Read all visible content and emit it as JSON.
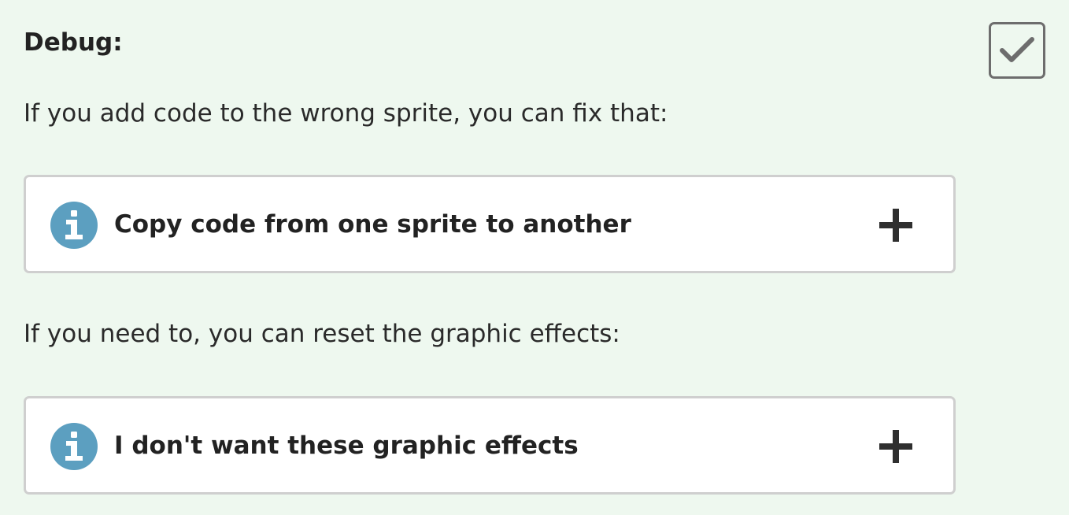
{
  "heading": "Debug:",
  "checkbox": {
    "checked": true,
    "icon": "check-icon"
  },
  "paragraphs": [
    "If you add code to the wrong sprite, you can fix that:",
    "If you need to, you can reset the graphic effects:"
  ],
  "panels": [
    {
      "title": "Copy code from one sprite to another",
      "icon": "info-icon",
      "toggle_icon": "plus-icon"
    },
    {
      "title": "I don't want these graphic effects",
      "icon": "info-icon",
      "toggle_icon": "plus-icon"
    }
  ],
  "colors": {
    "background": "#eef8ef",
    "info_icon": "#5c9fc0",
    "panel_border": "#cfcfcf",
    "checkbox_border": "#6d6d6d"
  }
}
